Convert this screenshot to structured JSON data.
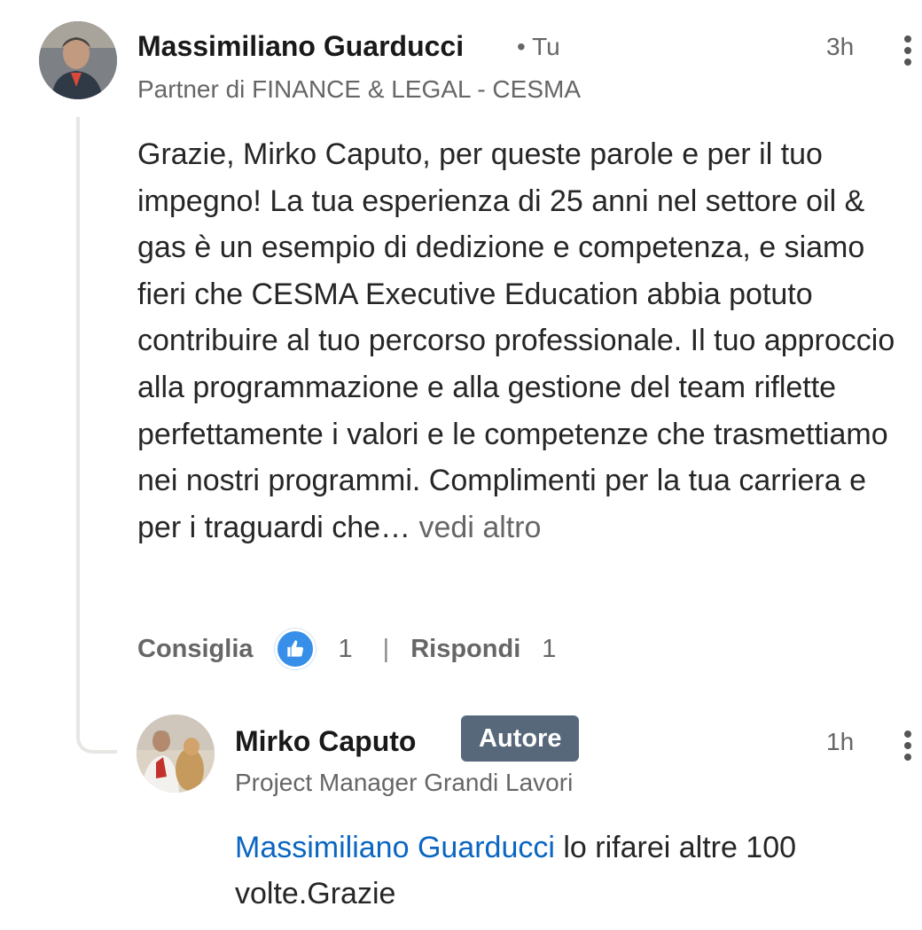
{
  "comment": {
    "author": "Massimiliano Guarducci",
    "degree": "• Tu",
    "headline": "Partner di FINANCE & LEGAL - CESMA",
    "time": "3h",
    "text": "Grazie, Mirko Caputo, per queste parole e per il tuo impegno! La tua esperienza di 25 anni nel settore oil & gas è un esempio di dedizione e competenza, e siamo fieri che CESMA Executive Education abbia potuto contribuire al tuo percorso professionale. Il tuo approccio alla programmazione e alla gestione del team riflette perfettamente i valori e le competenze che trasmettiamo nei nostri programmi. Complimenti per la tua carriera e per i traguardi che…",
    "see_more": "vedi altro",
    "like_label": "Consiglia",
    "like_count": "1",
    "separator": "|",
    "reply_label": "Rispondi",
    "reply_count": "1",
    "reaction_icon": "like-icon",
    "reaction_color": "#378fe9"
  },
  "reply": {
    "author": "Mirko Caputo",
    "badge": "Autore",
    "headline": "Project Manager Grandi Lavori",
    "time": "1h",
    "mention": "Massimiliano Guarducci",
    "text": " lo rifarei altre 100 volte.Grazie",
    "mention_color": "#0a66c2",
    "badge_color": "#56687a"
  }
}
